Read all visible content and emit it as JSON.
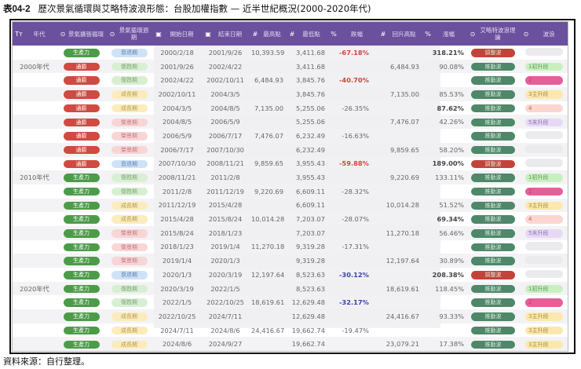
{
  "title": {
    "code": "表04-2",
    "text": "歷次景氣循環與艾略特波浪形態：台股加權指數 — 近半世紀概況(2000-2020年代)"
  },
  "headers": [
    {
      "icon": "Tт",
      "icon_name": "text-type-icon",
      "label": "年代"
    },
    {
      "icon": "⊙",
      "icon_name": "select-icon",
      "label": "景氣擴張循環"
    },
    {
      "icon": "⊙",
      "icon_name": "select-icon",
      "label": "景氣循環週期"
    },
    {
      "icon": "▣",
      "icon_name": "calendar-icon",
      "label": "開始日期"
    },
    {
      "icon": "▣",
      "icon_name": "calendar-icon",
      "label": "結束日期"
    },
    {
      "icon": "#",
      "icon_name": "number-icon",
      "label": "最高點"
    },
    {
      "icon": "#",
      "icon_name": "number-icon",
      "label": "最低點"
    },
    {
      "icon": "%",
      "icon_name": "percent-icon",
      "label": "跌幅"
    },
    {
      "icon": "#",
      "icon_name": "number-icon",
      "label": "回升高點"
    },
    {
      "icon": "%",
      "icon_name": "percent-icon",
      "label": "漲幅"
    },
    {
      "icon": "⊙",
      "icon_name": "select-icon",
      "label": "艾略特波浪理論"
    },
    {
      "icon": "⊙",
      "icon_name": "select-icon",
      "label": "波浪"
    }
  ],
  "colors": {
    "header": "#6b509e",
    "生產力": "#4c9b49",
    "通膨": "#cf4a40",
    "衰退期": [
      "#cfe2f6",
      "#5b7fb6"
    ],
    "復甦期": [
      "#d9efd4",
      "#7aa56f"
    ],
    "成長期": [
      "#fbecbd",
      "#b69a4b"
    ],
    "榮景期": [
      "#f8d5d6",
      "#c27a7c"
    ],
    "推動波": "#4e8769",
    "調整波": "#c2433a",
    "1初升段": [
      "#c9efc1",
      "#5d9a52"
    ],
    "2": [
      "#e65f96",
      "#c23d74"
    ],
    "3主升段": [
      "#fbe8ae",
      "#a88b3a"
    ],
    "4": [
      "#fbd6d0",
      "#c1625a"
    ],
    "5末升段": [
      "#e7d9f6",
      "#8b6fb0"
    ],
    "": [
      "#ebebee",
      "#999"
    ]
  },
  "rows": [
    {
      "decade": "",
      "expansion": "生產力",
      "cycle": "衰退期",
      "start": "2000/2/18",
      "end": "2001/9/26",
      "high": "10,393.59",
      "low": "3,411.68",
      "drop": "-67.18%",
      "drop_style": "red",
      "rebound": "",
      "rise": "318.21%",
      "rise_bold": true,
      "elliott": "調整波",
      "wave": ""
    },
    {
      "decade": "2000年代",
      "expansion": "通膨",
      "cycle": "復甦期",
      "start": "2001/9/26",
      "end": "2002/4/22",
      "high": "",
      "low": "3,411.68",
      "drop": "",
      "rebound": "6,484.93",
      "rise": "90.08%",
      "elliott": "推動波",
      "wave": "1初升段"
    },
    {
      "decade": "",
      "expansion": "通膨",
      "cycle": "復甦期",
      "start": "2002/4/22",
      "end": "2002/10/11",
      "high": "6,484.93",
      "low": "3,845.76",
      "drop": "-40.70%",
      "drop_style": "red",
      "rebound": "",
      "rise": "",
      "elliott": "推動波",
      "wave": "2"
    },
    {
      "decade": "",
      "expansion": "通膨",
      "cycle": "成長期",
      "start": "2002/10/11",
      "end": "2004/3/5",
      "high": "",
      "low": "3,845.76",
      "drop": "",
      "rebound": "7,135.00",
      "rise": "85.53%",
      "elliott": "推動波",
      "wave": "3主升段"
    },
    {
      "decade": "",
      "expansion": "通膨",
      "cycle": "成長期",
      "start": "2004/3/5",
      "end": "2004/8/5",
      "high": "7,135.00",
      "low": "5,255.06",
      "drop": "-26.35%",
      "rebound": "",
      "rise": "87.62%",
      "rise_bold": true,
      "elliott": "推動波",
      "wave": "4"
    },
    {
      "decade": "",
      "expansion": "通膨",
      "cycle": "榮景期",
      "start": "2004/8/5",
      "end": "2006/5/9",
      "high": "",
      "low": "5,255.06",
      "drop": "",
      "rebound": "7,476.07",
      "rise": "42.26%",
      "elliott": "推動波",
      "wave": "5末升段"
    },
    {
      "decade": "",
      "expansion": "通膨",
      "cycle": "榮景期",
      "start": "2006/5/9",
      "end": "2006/7/17",
      "high": "7,476.07",
      "low": "6,232.49",
      "drop": "-16.63%",
      "rebound": "",
      "rise": "",
      "elliott": "推動波",
      "wave": ""
    },
    {
      "decade": "",
      "expansion": "通膨",
      "cycle": "榮景期",
      "start": "2006/7/17",
      "end": "2007/10/30",
      "high": "",
      "low": "6,232.49",
      "drop": "",
      "rebound": "9,859.65",
      "rise": "58.20%",
      "elliott": "推動波",
      "wave": ""
    },
    {
      "decade": "",
      "expansion": "通膨",
      "cycle": "衰退期",
      "start": "2007/10/30",
      "end": "2008/11/21",
      "high": "9,859.65",
      "low": "3,955.43",
      "drop": "-59.88%",
      "drop_style": "red",
      "rebound": "",
      "rise": "189.00%",
      "rise_bold": true,
      "elliott": "調整波",
      "wave": ""
    },
    {
      "decade": "2010年代",
      "expansion": "生產力",
      "cycle": "復甦期",
      "start": "2008/11/21",
      "end": "2011/2/8",
      "high": "",
      "low": "3,955.43",
      "drop": "",
      "rebound": "9,220.69",
      "rise": "133.11%",
      "elliott": "推動波",
      "wave": "1初升段"
    },
    {
      "decade": "",
      "expansion": "生產力",
      "cycle": "復甦期",
      "start": "2011/2/8",
      "end": "2011/12/19",
      "high": "9,220.69",
      "low": "6,609.11",
      "drop": "-28.32%",
      "rebound": "",
      "rise": "",
      "elliott": "推動波",
      "wave": "2"
    },
    {
      "decade": "",
      "expansion": "生產力",
      "cycle": "成長期",
      "start": "2011/12/19",
      "end": "2015/4/28",
      "high": "",
      "low": "6,609.11",
      "drop": "",
      "rebound": "10,014.28",
      "rise": "51.52%",
      "elliott": "推動波",
      "wave": "3主升段"
    },
    {
      "decade": "",
      "expansion": "生產力",
      "cycle": "成長期",
      "start": "2015/4/28",
      "end": "2015/8/24",
      "high": "10,014.28",
      "low": "7,203.07",
      "drop": "-28.07%",
      "rebound": "",
      "rise": "69.34%",
      "rise_bold": true,
      "elliott": "推動波",
      "wave": "4"
    },
    {
      "decade": "",
      "expansion": "生產力",
      "cycle": "榮景期",
      "start": "2015/8/24",
      "end": "2018/1/23",
      "high": "",
      "low": "7,203.07",
      "drop": "",
      "rebound": "11,270.18",
      "rise": "56.46%",
      "elliott": "推動波",
      "wave": "5末升段"
    },
    {
      "decade": "",
      "expansion": "生產力",
      "cycle": "榮景期",
      "start": "2018/1/23",
      "end": "2019/1/4",
      "high": "11,270.18",
      "low": "9,319.28",
      "drop": "-17.31%",
      "rebound": "",
      "rise": "",
      "elliott": "推動波",
      "wave": ""
    },
    {
      "decade": "",
      "expansion": "生產力",
      "cycle": "榮景期",
      "start": "2019/1/4",
      "end": "2020/1/3",
      "high": "",
      "low": "9,319.28",
      "drop": "",
      "rebound": "12,197.64",
      "rise": "30.89%",
      "elliott": "推動波",
      "wave": ""
    },
    {
      "decade": "",
      "expansion": "生產力",
      "cycle": "衰退期",
      "start": "2020/1/3",
      "end": "2020/3/19",
      "high": "12,197.64",
      "low": "8,523.63",
      "drop": "-30.12%",
      "drop_style": "blue",
      "rebound": "",
      "rise": "208.38%",
      "rise_bold": true,
      "elliott": "調整波",
      "wave": ""
    },
    {
      "decade": "2020年代",
      "expansion": "生產力",
      "cycle": "復甦期",
      "start": "2020/3/19",
      "end": "2022/1/5",
      "high": "",
      "low": "8,523.63",
      "drop": "",
      "rebound": "18,619.61",
      "rise": "118.45%",
      "elliott": "推動波",
      "wave": "1初升段"
    },
    {
      "decade": "",
      "expansion": "生產力",
      "cycle": "復甦期",
      "start": "2022/1/5",
      "end": "2022/10/25",
      "high": "18,619.61",
      "low": "12,629.48",
      "drop": "-32.17%",
      "drop_style": "blue",
      "rebound": "",
      "rise": "",
      "elliott": "推動波",
      "wave": "2"
    },
    {
      "decade": "",
      "expansion": "生產力",
      "cycle": "成長期",
      "start": "2022/10/25",
      "end": "2024/7/11",
      "high": "",
      "low": "12,629.48",
      "drop": "",
      "rebound": "24,416.67",
      "rise": "93.33%",
      "elliott": "推動波",
      "wave": "3主升段"
    },
    {
      "decade": "",
      "expansion": "生產力",
      "cycle": "成長期",
      "start": "2024/7/11",
      "end": "2024/8/6",
      "high": "24,416.67",
      "low": "19,662.74",
      "drop": "-19.47%",
      "rebound": "",
      "rise": "",
      "elliott": "推動波",
      "wave": "3主升段"
    },
    {
      "decade": "",
      "expansion": "生產力",
      "cycle": "成長期",
      "start": "2024/8/6",
      "end": "2024/9/27",
      "high": "",
      "low": "19,662.74",
      "drop": "",
      "rebound": "23,079.21",
      "rise": "17.38%",
      "elliott": "推動波",
      "wave": "3主升段"
    }
  ],
  "footer": "資料來源：自行整理。"
}
